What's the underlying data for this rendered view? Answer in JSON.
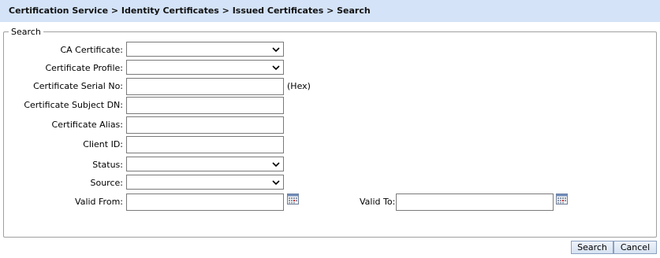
{
  "breadcrumb": "Certification Service > Identity Certificates > Issued Certificates > Search",
  "search": {
    "legend": "Search",
    "fields": {
      "ca_certificate": {
        "label": "CA Certificate:",
        "value": ""
      },
      "certificate_profile": {
        "label": "Certificate Profile:",
        "value": ""
      },
      "serial_no": {
        "label": "Certificate Serial No:",
        "value": "",
        "suffix": "(Hex)"
      },
      "subject_dn": {
        "label": "Certificate Subject DN:",
        "value": ""
      },
      "alias": {
        "label": "Certificate Alias:",
        "value": ""
      },
      "client_id": {
        "label": "Client ID:",
        "value": ""
      },
      "status": {
        "label": "Status:",
        "value": ""
      },
      "source": {
        "label": "Source:",
        "value": ""
      },
      "valid_from": {
        "label": "Valid From:",
        "value": ""
      },
      "valid_to": {
        "label": "Valid To:",
        "value": ""
      }
    }
  },
  "buttons": {
    "search": "Search",
    "cancel": "Cancel"
  },
  "icons": {
    "dropdown": "chevron-down-icon",
    "calendar": "calendar-icon"
  },
  "colors": {
    "header_bg": "#d4e3f7",
    "button_border": "#8aa0c0"
  }
}
